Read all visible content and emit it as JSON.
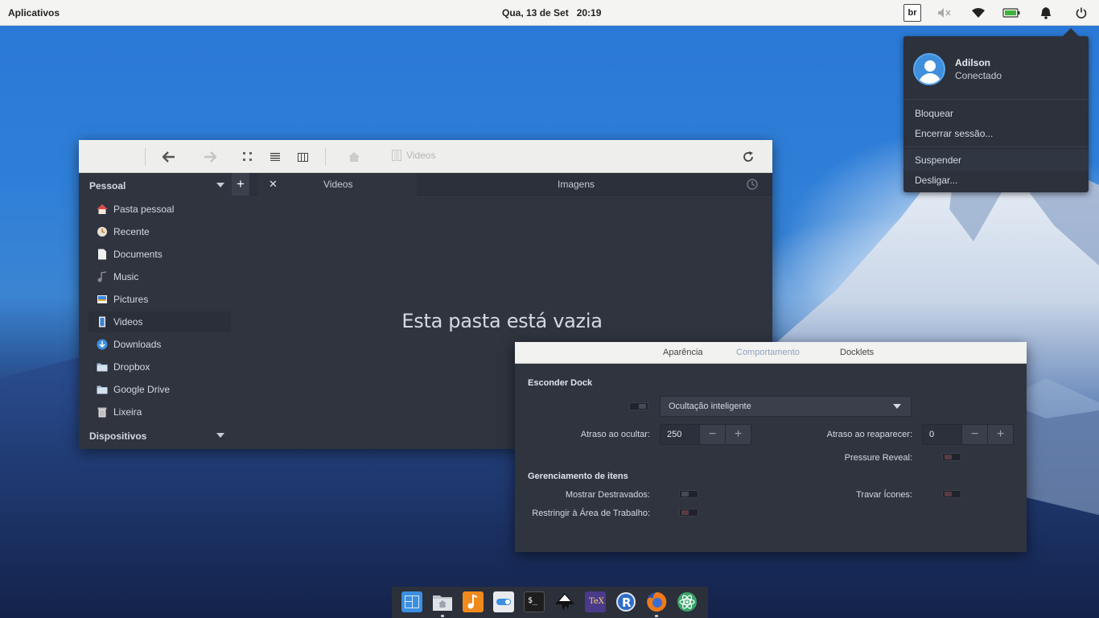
{
  "top_panel": {
    "apps_label": "Aplicativos",
    "date": "Qua, 13 de Set",
    "time": "20:19",
    "keyboard_layout": "br",
    "icons": [
      "volume-muted-icon",
      "wifi-icon",
      "battery-icon",
      "bell-icon",
      "power-icon"
    ]
  },
  "session_menu": {
    "user_name": "Adilson",
    "user_status": "Conectado",
    "items": [
      "Bloquear",
      "Encerrar sessão...",
      "Suspender",
      "Desligar..."
    ]
  },
  "file_manager": {
    "path_label": "Videos",
    "sidebar": {
      "personal_header": "Pessoal",
      "items": [
        {
          "label": "Pasta pessoal",
          "icon": "home-icon"
        },
        {
          "label": "Recente",
          "icon": "recent-icon"
        },
        {
          "label": "Documents",
          "icon": "document-icon"
        },
        {
          "label": "Music",
          "icon": "music-icon"
        },
        {
          "label": "Pictures",
          "icon": "pictures-icon"
        },
        {
          "label": "Videos",
          "icon": "videos-icon"
        },
        {
          "label": "Downloads",
          "icon": "downloads-icon"
        },
        {
          "label": "Dropbox",
          "icon": "folder-icon"
        },
        {
          "label": "Google Drive",
          "icon": "folder-icon"
        },
        {
          "label": "Lixeira",
          "icon": "trash-icon"
        }
      ],
      "devices_header": "Dispositivos"
    },
    "tabs": [
      "Videos",
      "Imagens"
    ],
    "empty_message": "Esta pasta está vazia"
  },
  "dock_prefs": {
    "tabs": [
      "Aparência",
      "Comportamento",
      "Docklets"
    ],
    "hide_section": "Esconder Dock",
    "hide_mode": "Ocultação inteligente",
    "hide_delay_label": "Atraso ao ocultar:",
    "hide_delay_value": "250",
    "unhide_delay_label": "Atraso ao reaparecer:",
    "unhide_delay_value": "0",
    "pressure_reveal_label": "Pressure Reveal:",
    "items_section": "Gerenciamento de itens",
    "show_unpinned_label": "Mostrar Destravados:",
    "lock_icons_label": "Travar Ícones:",
    "restrict_workspace_label": "Restringir à Área de Trabalho:"
  },
  "dock": {
    "items": [
      "workspace-switcher-icon",
      "files-icon",
      "music-player-icon",
      "settings-toggle-icon",
      "terminal-icon",
      "inkscape-icon",
      "tex-icon",
      "r-icon",
      "firefox-icon",
      "atom-icon"
    ]
  },
  "colors": {
    "panel_bg": "#f4f4f2",
    "window_dark": "#2f343f",
    "accent_blue": "#3e8fdc",
    "wallpaper_sky": "#2f7fd8"
  }
}
